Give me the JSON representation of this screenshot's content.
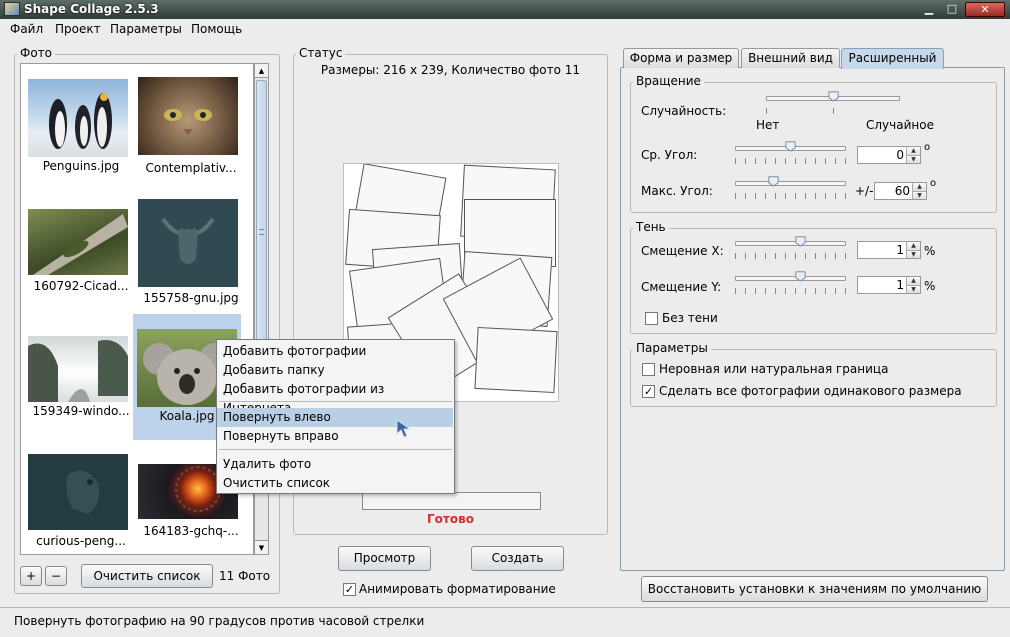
{
  "window": {
    "title": "Shape Collage 2.5.3"
  },
  "menubar": {
    "items": [
      "Файл",
      "Проект",
      "Параметры",
      "Помощь"
    ]
  },
  "photos": {
    "legend": "Фото",
    "items": [
      {
        "name": "Penguins.jpg"
      },
      {
        "name": "Contemplativ..."
      },
      {
        "name": "160792-Cicad..."
      },
      {
        "name": "155758-gnu.jpg"
      },
      {
        "name": "159349-windo..."
      },
      {
        "name": "Koala.jpg"
      },
      {
        "name": "curious-peng..."
      },
      {
        "name": "164183-gchq-..."
      }
    ],
    "add_label": "+",
    "remove_label": "−",
    "clear_label": "Очистить список",
    "count_label": "11 Фото"
  },
  "status": {
    "legend": "Статус",
    "info": "Размеры: 216 x 239, Количество фото 11",
    "ready": "Готово",
    "ready_color": "#d03030"
  },
  "actions": {
    "preview_label": "Просмотр",
    "create_label": "Создать",
    "animate_label": "Анимировать форматирование",
    "animate_checked": true
  },
  "context_menu": {
    "items": [
      "Добавить фотографии",
      "Добавить папку",
      "Добавить фотографии из Интернета",
      "Повернуть влево",
      "Повернуть вправо",
      "Удалить фото",
      "Очистить список"
    ],
    "highlighted": "Повернуть влево"
  },
  "tabs": [
    "Форма и размер",
    "Внешний вид",
    "Расширенный"
  ],
  "active_tab": "Расширенный",
  "rotation": {
    "legend": "Вращение",
    "randomness_label": "Случайность:",
    "randomness_level": 0.5,
    "left_label": "Нет",
    "right_label": "Случайное",
    "avg_angle_label": "Ср. Угол:",
    "avg_angle_value": "0",
    "avg_angle_level": 0.5,
    "max_angle_label": "Макс. Угол:",
    "max_angle_prefix": "+/-",
    "max_angle_value": "60",
    "max_angle_level": 0.33,
    "degree": "o"
  },
  "shadow": {
    "legend": "Тень",
    "offset_x_label": "Смещение X:",
    "offset_x_value": "1",
    "offset_x_level": 0.6,
    "offset_y_label": "Смещение Y:",
    "offset_y_value": "1",
    "offset_y_level": 0.6,
    "percent": "%",
    "no_shadow_label": "Без тени",
    "no_shadow_checked": false
  },
  "params": {
    "legend": "Параметры",
    "uneven_label": "Неровная или натуральная граница",
    "uneven_checked": false,
    "same_size_label": "Сделать все фотографии одинакового размера",
    "same_size_checked": true
  },
  "restore_label": "Восстановить установки к значениям по умолчанию",
  "statusbar": {
    "text": "Повернуть фотографию на 90 градусов против часовой стрелки"
  },
  "colors": {
    "accent": "#c7d8ea",
    "highlight": "#b9cfe6",
    "selected_thumb": "#bcd2ea"
  }
}
